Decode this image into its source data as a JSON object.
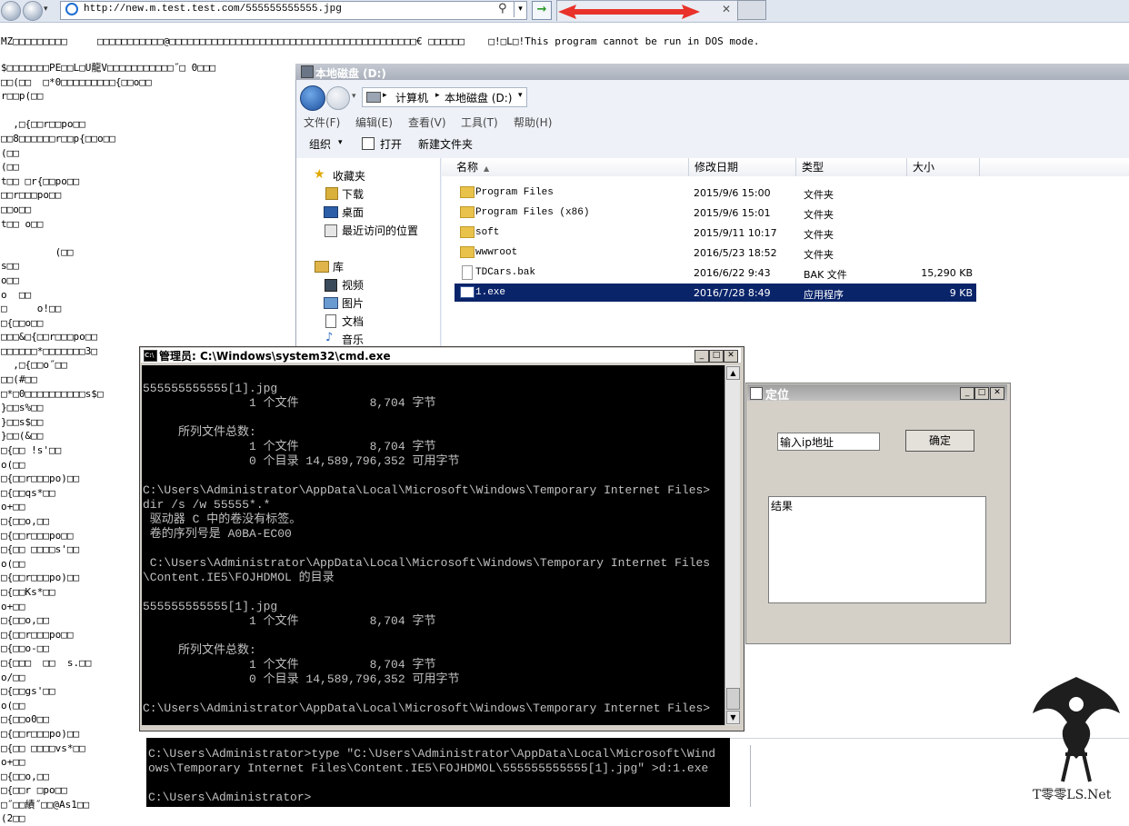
{
  "browser": {
    "url": "http://new.m.test.test.com/555555555555.jpg",
    "go_arrow": "→",
    "tab_close": "✕"
  },
  "raw_header": "MZ□□□□□□□□□     □□□□□□□□□□□@□□□□□□□□□□□□□□□□□□□□□□□□□□□□□□□□□□□□□□□□□€ □□□□□□    □!□L□!This program cannot be run in DOS mode.",
  "raw_lines": [
    "$□□□□□□□PE□□L□U龍V□□□□□□□□□□□˝□ 0□□□",
    "□□(□□  □*0□□□□□□□□□{□□o□□",
    "r□□p(□□",
    "",
    "  ,□{□□r□□po□□",
    "□□8□□□□□□r□□p{□□o□□",
    "(□□",
    "(□□",
    "t□□ □r{□□po□□",
    "□□r□□□po□□",
    "□□o□□",
    "t□□ o□□",
    "",
    "         (□□",
    "s□□",
    "o□□",
    "o  □□",
    "□     o!□□",
    "□{□□o□□",
    "□□□&□{□□r□□□po□□",
    "□□□□□□*□□□□□□□3□",
    "  ,□{□□o˝□□",
    "□□(#□□",
    "□*□0□□□□□□□□□□s$□",
    "}□□s%□□",
    "}□□s$□□",
    "}□□(&□□",
    "□{□□ !s'□□",
    "o(□□",
    "□{□□r□□□po)□□",
    "□{□□qs*□□",
    "o+□□",
    "□{□□o,□□",
    "□{□□r□□□po□□",
    "□{□□ □□□□s'□□",
    "o(□□",
    "□{□□r□□□po)□□",
    "□{□□Ks*□□",
    "o+□□",
    "□{□□o,□□",
    "□{□□r□□□po□□",
    "□{□□o-□□",
    "□{□□□  □□  s.□□",
    "o/□□",
    "□{□□gs'□□",
    "o(□□",
    "□{□□o0□□",
    "□{□□r□□□po)□□",
    "□{□□ □□□□vs*□□",
    "o+□□",
    "□{□□o,□□",
    "□{□□r □po□□",
    "□˝□□績˝□□@As1□□",
    "(2□□"
  ],
  "explorer": {
    "title": "本地磁盘 (D:)",
    "breadcrumb": [
      "计算机",
      "本地磁盘 (D:)"
    ],
    "menu": [
      "文件(F)",
      "编辑(E)",
      "查看(V)",
      "工具(T)",
      "帮助(H)"
    ],
    "toolbar": {
      "organize": "组织",
      "open": "打开",
      "new_folder": "新建文件夹"
    },
    "favorites_label": "收藏夹",
    "favorites": [
      "下载",
      "桌面",
      "最近访问的位置"
    ],
    "library_label": "库",
    "libraries": [
      "视频",
      "图片",
      "文档",
      "音乐"
    ],
    "columns": {
      "name": "名称",
      "date": "修改日期",
      "type": "类型",
      "size": "大小"
    },
    "files": [
      {
        "name": "Program Files",
        "date": "2015/9/6 15:00",
        "type": "文件夹",
        "size": "",
        "kind": "folder"
      },
      {
        "name": "Program Files (x86)",
        "date": "2015/9/6 15:01",
        "type": "文件夹",
        "size": "",
        "kind": "folder"
      },
      {
        "name": "soft",
        "date": "2015/9/11 10:17",
        "type": "文件夹",
        "size": "",
        "kind": "folder"
      },
      {
        "name": "wwwroot",
        "date": "2016/5/23 18:52",
        "type": "文件夹",
        "size": "",
        "kind": "folder"
      },
      {
        "name": "TDCars.bak",
        "date": "2016/6/22 9:43",
        "type": "BAK 文件",
        "size": "15,290 KB",
        "kind": "file"
      },
      {
        "name": "1.exe",
        "date": "2016/7/28 8:49",
        "type": "应用程序",
        "size": "9 KB",
        "kind": "exe",
        "selected": true
      }
    ]
  },
  "cmd": {
    "title": "管理员: C:\\Windows\\system32\\cmd.exe",
    "lines": [
      "555555555555[1].jpg",
      "               1 个文件          8,704 字节",
      "",
      "     所列文件总数:",
      "               1 个文件          8,704 字节",
      "               0 个目录 14,589,796,352 可用字节",
      "",
      "C:\\Users\\Administrator\\AppData\\Local\\Microsoft\\Windows\\Temporary Internet Files>",
      "dir /s /w 55555*.*",
      " 驱动器 C 中的卷没有标签。",
      " 卷的序列号是 A0BA-EC00",
      "",
      " C:\\Users\\Administrator\\AppData\\Local\\Microsoft\\Windows\\Temporary Internet Files",
      "\\Content.IE5\\FOJHDMOL 的目录",
      "",
      "555555555555[1].jpg",
      "               1 个文件          8,704 字节",
      "",
      "     所列文件总数:",
      "               1 个文件          8,704 字节",
      "               0 个目录 14,589,796,352 可用字节",
      "",
      "C:\\Users\\Administrator\\AppData\\Local\\Microsoft\\Windows\\Temporary Internet Files>"
    ],
    "lines2": [
      "C:\\Users\\Administrator>type \"C:\\Users\\Administrator\\AppData\\Local\\Microsoft\\Wind",
      "ows\\Temporary Internet Files\\Content.IE5\\FOJHDMOL\\555555555555[1].jpg\" >d:1.exe",
      "",
      "C:\\Users\\Administrator>"
    ]
  },
  "locate": {
    "title": "定位",
    "input_value": "输入ip地址",
    "confirm": "确定",
    "result": "结果"
  },
  "watermark": {
    "text": "T零零LS.Net"
  },
  "colors": {
    "selection": "#0a246a",
    "annotation_arrow": "#e8322a"
  }
}
